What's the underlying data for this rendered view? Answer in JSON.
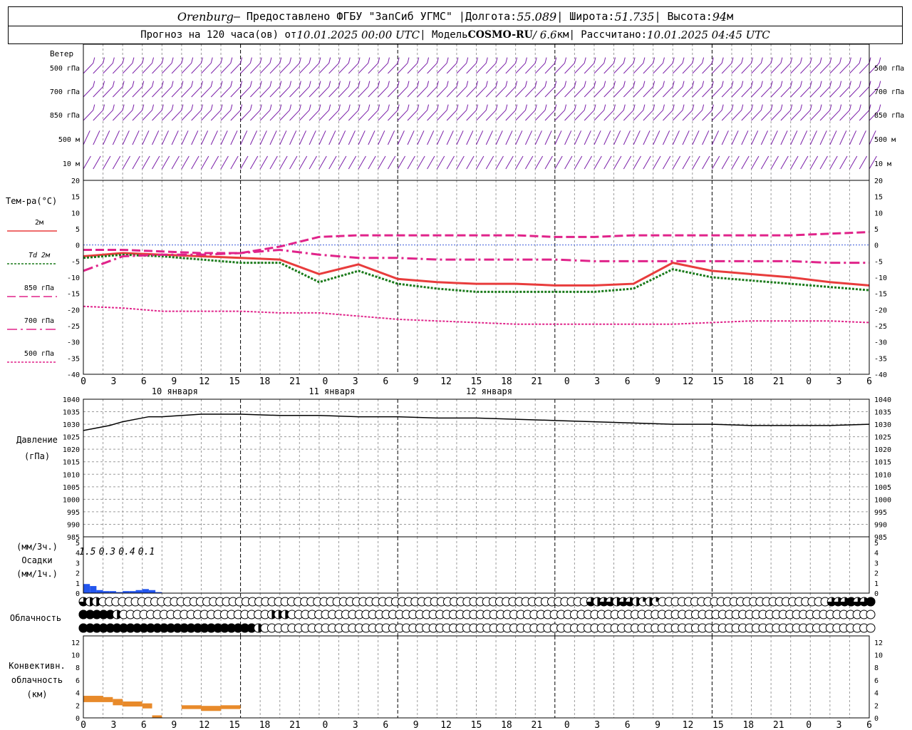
{
  "header": {
    "city": "Orenburg",
    "provider": "— Предоставлено ФГБУ \"ЗапСиб УГМС\" |",
    "lon_label": "Долгота:",
    "lon": "55.089",
    "lat_label": "| Широта:",
    "lat": "51.735",
    "alt_label": "| Высота:",
    "alt": "94",
    "alt_unit": "м",
    "forecast_label": "Прогноз на 120 часа(ов) от",
    "start_time": "10.01.2025 00:00 UTC",
    "model_label": "| Модель",
    "model": "COSMO-RU",
    "resolution": "/ 6.6",
    "res_unit": "км",
    "calc_label": "| Рассчитано:",
    "calc_time": "10.01.2025 04:45 UTC"
  },
  "chart_data": [
    {
      "type": "wind-barbs",
      "label": "Ветер",
      "levels": [
        "500 гПа",
        "700 гПа",
        "850 гПа",
        "500 м",
        "10 м"
      ],
      "color": "#7a1ea8"
    },
    {
      "type": "line",
      "ylabel": "Тем-ра(°C)",
      "ylim": [
        -40,
        20
      ],
      "y_ticks": [
        20,
        15,
        10,
        5,
        0,
        -5,
        -10,
        -15,
        -20,
        -25,
        -30,
        -35,
        -40
      ],
      "x_ticks": [
        "0",
        "3",
        "6",
        "9",
        "12",
        "15",
        "18",
        "21",
        "0",
        "3",
        "6",
        "9",
        "12",
        "15",
        "18",
        "21",
        "0",
        "3",
        "6",
        "9",
        "12",
        "15",
        "18",
        "21",
        "0",
        "3",
        "6"
      ],
      "days": [
        "10 января",
        "11 января",
        "12 января"
      ],
      "series": [
        {
          "name": "2м",
          "color": "#e83c3c",
          "style": "solid",
          "x": [
            0,
            6,
            12,
            18,
            24,
            30,
            36,
            42,
            48,
            54,
            60,
            66,
            72,
            78,
            84,
            90,
            96,
            102,
            108,
            114,
            120
          ],
          "y": [
            -3.5,
            -2.5,
            -3.0,
            -3.5,
            -4.0,
            -4.5,
            -9.0,
            -6.0,
            -10.5,
            -11.5,
            -12.0,
            -12.0,
            -12.5,
            -12.5,
            -12.0,
            -5.5,
            -8.0,
            -9.0,
            -10.0,
            -11.5,
            -12.5
          ]
        },
        {
          "name": "Td 2м",
          "color": "#1a7a1a",
          "style": "dotted",
          "x": [
            0,
            6,
            12,
            18,
            24,
            30,
            36,
            42,
            48,
            54,
            60,
            66,
            72,
            78,
            84,
            90,
            96,
            102,
            108,
            114,
            120
          ],
          "y": [
            -4.0,
            -3.0,
            -3.5,
            -4.5,
            -5.5,
            -5.5,
            -11.5,
            -8.0,
            -12.0,
            -13.5,
            -14.5,
            -14.5,
            -14.5,
            -14.5,
            -13.5,
            -7.5,
            -10.0,
            -11.0,
            -12.0,
            -13.0,
            -14.0
          ]
        },
        {
          "name": "850 гПа",
          "color": "#e0238a",
          "style": "dashed",
          "x": [
            0,
            6,
            12,
            18,
            24,
            30,
            36,
            42,
            48,
            54,
            60,
            66,
            72,
            78,
            84,
            90,
            96,
            102,
            108,
            114,
            120
          ],
          "y": [
            -1.5,
            -1.5,
            -2.0,
            -2.5,
            -2.5,
            -0.5,
            2.5,
            3.0,
            3.0,
            3.0,
            3.0,
            3.0,
            2.5,
            2.5,
            3.0,
            3.0,
            3.0,
            3.0,
            3.0,
            3.5,
            4.0
          ]
        },
        {
          "name": "700 гПа",
          "color": "#e0238a",
          "style": "dashdot",
          "x": [
            0,
            6,
            12,
            18,
            24,
            30,
            36,
            42,
            48,
            54,
            60,
            66,
            72,
            78,
            84,
            90,
            96,
            102,
            108,
            114,
            120
          ],
          "y": [
            -8.0,
            -3.5,
            -3.0,
            -3.0,
            -2.5,
            -1.5,
            -3.0,
            -4.0,
            -4.0,
            -4.5,
            -4.5,
            -4.5,
            -4.5,
            -5.0,
            -5.0,
            -5.0,
            -5.0,
            -5.0,
            -5.0,
            -5.5,
            -5.5
          ]
        },
        {
          "name": "500 гПа",
          "color": "#e0238a",
          "style": "dotted",
          "x": [
            0,
            6,
            12,
            18,
            24,
            30,
            36,
            42,
            48,
            54,
            60,
            66,
            72,
            78,
            84,
            90,
            96,
            102,
            108,
            114,
            120
          ],
          "y": [
            -19.0,
            -19.5,
            -20.5,
            -20.5,
            -20.5,
            -21.0,
            -21.0,
            -22.0,
            -23.0,
            -23.5,
            -24.0,
            -24.5,
            -24.5,
            -24.5,
            -24.5,
            -24.5,
            -24.0,
            -23.5,
            -23.5,
            -23.5,
            -24.0
          ]
        }
      ]
    },
    {
      "type": "line",
      "ylabel": "Давление",
      "ylabel2": "(гПа)",
      "ylim": [
        985,
        1040
      ],
      "y_ticks": [
        1040,
        1035,
        1030,
        1025,
        1020,
        1015,
        1010,
        1005,
        1000,
        995,
        990,
        985
      ],
      "series": [
        {
          "name": "",
          "color": "#000000",
          "x": [
            0,
            2,
            4,
            6,
            8,
            10,
            12,
            18,
            24,
            30,
            36,
            42,
            48,
            54,
            60,
            66,
            72,
            78,
            84,
            90,
            96,
            102,
            108,
            114,
            120
          ],
          "y": [
            1027.5,
            1028.5,
            1029.5,
            1031,
            1032,
            1033,
            1033,
            1034,
            1034,
            1033.5,
            1033.5,
            1033,
            1033,
            1032.5,
            1032.5,
            1032,
            1031.5,
            1031,
            1030.5,
            1030,
            1030,
            1029.5,
            1029.5,
            1029.5,
            1030
          ]
        }
      ]
    },
    {
      "type": "bar",
      "ylabel_top": "(мм/3ч.)",
      "ylabel": "Осадки",
      "ylabel_bottom": "(мм/1ч.)",
      "ylim": [
        0,
        5
      ],
      "y_ticks": [
        5,
        4,
        3,
        2,
        1,
        0
      ],
      "totals": [
        {
          "x": 1.5,
          "label": "1.5"
        },
        {
          "x": 4.5,
          "label": "0.3"
        },
        {
          "x": 7.5,
          "label": "0.4"
        },
        {
          "x": 10.5,
          "label": "0.1"
        }
      ],
      "color": "#2255ee",
      "x": [
        0,
        1,
        2,
        3,
        4,
        5,
        6,
        7,
        8,
        9,
        10,
        11
      ],
      "values": [
        0.9,
        0.7,
        0.3,
        0.2,
        0.2,
        0.1,
        0.2,
        0.2,
        0.3,
        0.4,
        0.3,
        0.1
      ]
    },
    {
      "type": "cloud-cover",
      "ylabel": "Облачность",
      "rows": [
        [
          75,
          50,
          50,
          0,
          0,
          0,
          0,
          0,
          0,
          0,
          0,
          0,
          0,
          0,
          0,
          0,
          0,
          0,
          0,
          0,
          0,
          0,
          0,
          0,
          0,
          0,
          0,
          0,
          0,
          0,
          0,
          0,
          0,
          0,
          0,
          0,
          0,
          0,
          0,
          0,
          0,
          0,
          0,
          0,
          0,
          0,
          0,
          0,
          0,
          0,
          0,
          0,
          0,
          0,
          0,
          0,
          0,
          0,
          0,
          0,
          0,
          0,
          0,
          0,
          0,
          0,
          0,
          0,
          0,
          0,
          0,
          0,
          0,
          0,
          0,
          0,
          0,
          0,
          75,
          50,
          75,
          75,
          50,
          75,
          75,
          50,
          25,
          50,
          25,
          0,
          0,
          0,
          0,
          0,
          0,
          0,
          0,
          0,
          0,
          0,
          0,
          0,
          0,
          0,
          0,
          0,
          0,
          0,
          0,
          0,
          0,
          0,
          0,
          0,
          0,
          75,
          75,
          75,
          100,
          75,
          75,
          100
        ],
        [
          100,
          100,
          100,
          100,
          100,
          50,
          0,
          0,
          0,
          0,
          0,
          0,
          0,
          0,
          0,
          0,
          0,
          0,
          0,
          0,
          0,
          0,
          0,
          0,
          0,
          0,
          0,
          0,
          50,
          50,
          50,
          0,
          0,
          0,
          0,
          0,
          0,
          0,
          0,
          0,
          0,
          0,
          0,
          0,
          0,
          0,
          0,
          0,
          0,
          0,
          0,
          0,
          0,
          0,
          0,
          0,
          0,
          0,
          0,
          0,
          0,
          0,
          0,
          0,
          0,
          0,
          0,
          0,
          0,
          0,
          0,
          0,
          0,
          0,
          0,
          0,
          0,
          0,
          0,
          0,
          0,
          0,
          0,
          0,
          0,
          0,
          0,
          0,
          0,
          0,
          0,
          0,
          0,
          0,
          0,
          0,
          0,
          0,
          0,
          0,
          0,
          0,
          0,
          0,
          0,
          0,
          0,
          0,
          0,
          0,
          0,
          0,
          0,
          0,
          0,
          0,
          0,
          0
        ],
        [
          100,
          100,
          100,
          100,
          100,
          100,
          100,
          100,
          100,
          100,
          100,
          100,
          100,
          100,
          100,
          100,
          100,
          100,
          100,
          100,
          100,
          100,
          100,
          100,
          100,
          100,
          50,
          0,
          0,
          0,
          0,
          0,
          0,
          0,
          0,
          0,
          0,
          0,
          0,
          0,
          0,
          0,
          0,
          0,
          0,
          0,
          0,
          0,
          0,
          0,
          0,
          0,
          0,
          0,
          0,
          0,
          0,
          0,
          0,
          0,
          0,
          0,
          0,
          0,
          0,
          0,
          0,
          0,
          0,
          0,
          0,
          0,
          0,
          0,
          0,
          0,
          0,
          0,
          0,
          0,
          0,
          0,
          0,
          0,
          0,
          0,
          0,
          0,
          0,
          0,
          0,
          0,
          0,
          0,
          0,
          0,
          0,
          0,
          0,
          0,
          0,
          0,
          0,
          0,
          0,
          0,
          0,
          0,
          0,
          0,
          0,
          0,
          0,
          0,
          0,
          0,
          0,
          0
        ]
      ]
    },
    {
      "type": "bar",
      "ylabel": "Конвективн.",
      "ylabel2": "облачность",
      "ylabel3": "(км)",
      "ylim": [
        0,
        13
      ],
      "y_ticks": [
        12,
        10,
        8,
        6,
        4,
        2,
        0
      ],
      "color": "#e88a2a",
      "segments": [
        {
          "x0": 0,
          "x1": 3,
          "y0": 2.5,
          "y1": 3.5
        },
        {
          "x0": 3,
          "x1": 4.5,
          "y0": 2.5,
          "y1": 3.3
        },
        {
          "x0": 4.5,
          "x1": 6,
          "y0": 2.0,
          "y1": 3.0
        },
        {
          "x0": 6,
          "x1": 9,
          "y0": 1.8,
          "y1": 2.6
        },
        {
          "x0": 9,
          "x1": 10.5,
          "y0": 1.5,
          "y1": 2.3
        },
        {
          "x0": 10.5,
          "x1": 12,
          "y0": 0,
          "y1": 0.4
        },
        {
          "x0": 15,
          "x1": 18,
          "y0": 1.4,
          "y1": 2.0
        },
        {
          "x0": 18,
          "x1": 21,
          "y0": 1.1,
          "y1": 1.9
        },
        {
          "x0": 21,
          "x1": 24,
          "y0": 1.4,
          "y1": 2.0
        }
      ]
    }
  ]
}
